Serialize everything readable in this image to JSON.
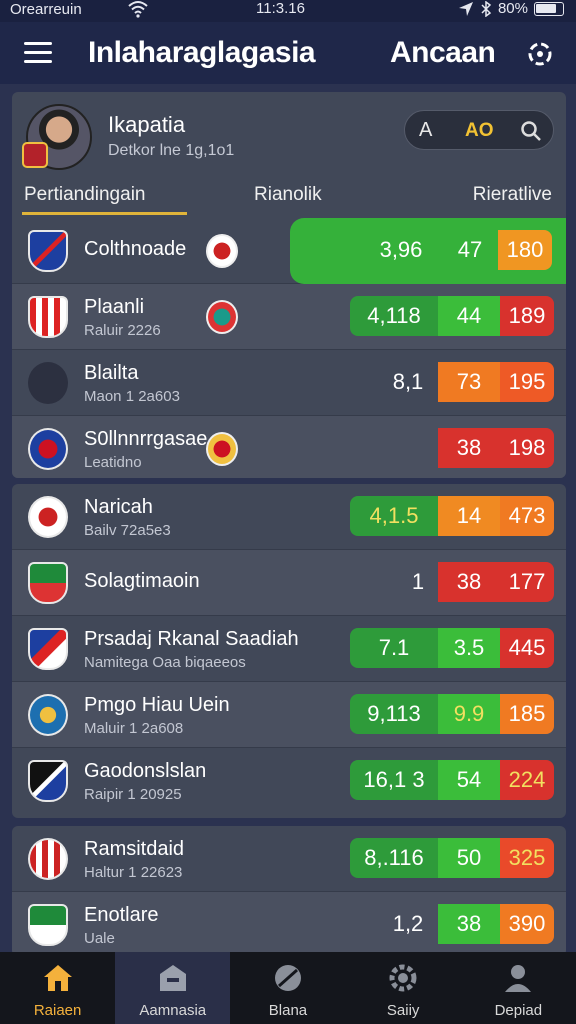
{
  "status_bar": {
    "carrier": "Orearreuin",
    "time": "11:3.16",
    "battery": "80%"
  },
  "header": {
    "title": "Inlaharaglagasia",
    "action_label": "Ancaan"
  },
  "profile": {
    "name": "Ikapatia",
    "subtitle": "Detkor lne 1g,1o1",
    "pill_left": "A",
    "pill_value": "AO"
  },
  "tabs": [
    "Pertiandingain",
    "Rianolik",
    "Rieratlive"
  ],
  "card1_rows": [
    {
      "name": "Colthnoade",
      "sub": "",
      "score": [
        "3,96",
        "47",
        "180"
      ]
    },
    {
      "name": "Plaanli",
      "sub": "Raluir 2226",
      "score": [
        "4,118",
        "44",
        "189"
      ]
    },
    {
      "name": "Blailta",
      "sub": "Maon 1 2a603",
      "score": [
        "8,1",
        "73",
        "195"
      ]
    },
    {
      "name": "S0llnnrrgasae",
      "sub": "Leatidno",
      "score": [
        "",
        "38",
        "198"
      ]
    }
  ],
  "card2_rows": [
    {
      "name": "Naricah",
      "sub": "Bailv 72a5e3",
      "score": [
        "4,1.5",
        "14",
        "473"
      ]
    },
    {
      "name": "Solagtimaoin",
      "sub": "",
      "score": [
        "1",
        "38",
        "177"
      ]
    },
    {
      "name": "Prsadaj Rkanal Saadiah",
      "sub": "Namitega Oaa biqaeeos",
      "score": [
        "7.1",
        "3.5",
        "445"
      ]
    },
    {
      "name": "Pmgo Hiau Uein",
      "sub": "Maluir 1 2a608",
      "score": [
        "9,113",
        "9.9",
        "185"
      ]
    },
    {
      "name": "Gaodonslslan",
      "sub": "Raipir 1 20925",
      "score": [
        "16,1 3",
        "54",
        "224"
      ]
    }
  ],
  "card3_rows": [
    {
      "name": "Ramsitdaid",
      "sub": "Haltur 1 22623",
      "score": [
        "8,.116",
        "50",
        "325"
      ]
    },
    {
      "name": "Enotlare",
      "sub": "Uale",
      "score": [
        "1,2",
        "38",
        "390"
      ]
    }
  ],
  "nav": [
    {
      "label": "Raiaen",
      "icon": "home-icon"
    },
    {
      "label": "Aamnasia",
      "icon": "building-icon"
    },
    {
      "label": "Blana",
      "icon": "ball-icon"
    },
    {
      "label": "Saiiy",
      "icon": "gear-icon"
    },
    {
      "label": "Depiad",
      "icon": "person-icon"
    }
  ],
  "colors": {
    "accent": "#e0b43a",
    "header_bg": "#1f2749",
    "card_bg": "#414858",
    "green": "#3bbd3a",
    "red": "#d8322d",
    "orange": "#f07a22"
  }
}
